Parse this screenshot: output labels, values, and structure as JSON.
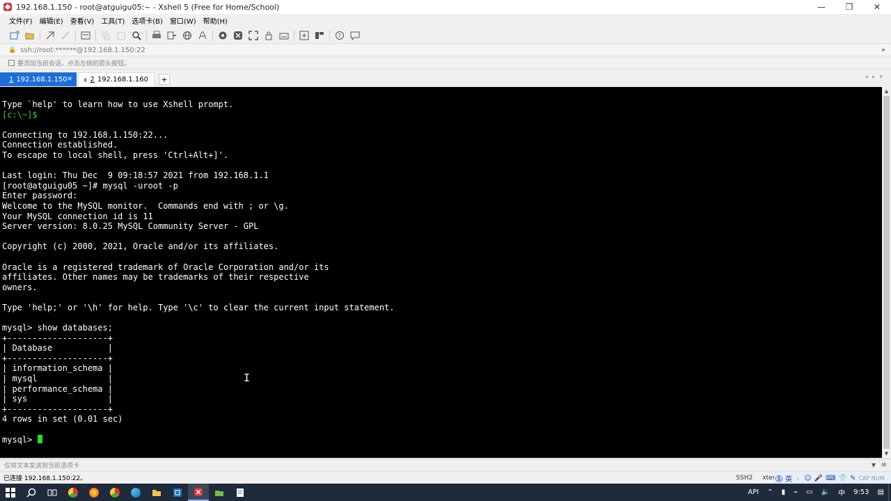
{
  "window": {
    "title": "192.168.1.150 - root@atguigu05:~ - Xshell 5 (Free for Home/School)",
    "controls": [
      "—",
      "❐",
      "✕"
    ]
  },
  "menu": [
    "文件(F)",
    "编辑(E)",
    "查看(V)",
    "工具(T)",
    "选项卡(B)",
    "窗口(W)",
    "帮助(H)"
  ],
  "toolbar_icons": [
    "new-session-icon",
    "open-folder-icon",
    "reconnect-icon",
    "disconnect-icon",
    "properties-icon",
    "copy-icon",
    "paste-icon",
    "find-icon",
    "print-icon",
    "transfer-icon",
    "globe-icon",
    "font-icon",
    "xftp-icon",
    "xshell-icon",
    "fullscreen-icon",
    "lock-icon",
    "keyboard-icon",
    "add-icon",
    "layout-icon",
    "help-icon",
    "chat-icon"
  ],
  "address": {
    "url": "ssh://root:******@192.168.1.150:22"
  },
  "hint": {
    "text": "要添加当前会话，点击左侧的箭头按钮。"
  },
  "tabs": [
    {
      "num": "1",
      "label": "192.168.1.150",
      "active": true,
      "dot_color": "#3cd23c"
    },
    {
      "num": "2",
      "label": "192.168.1.160",
      "active": false,
      "dot_color": "#2db32d"
    }
  ],
  "terminal": {
    "lines": [
      "Type `help' to learn how to use Xshell prompt.",
      "[c:\\~]$",
      "",
      "Connecting to 192.168.1.150:22...",
      "Connection established.",
      "To escape to local shell, press 'Ctrl+Alt+]'.",
      "",
      "Last login: Thu Dec  9 09:18:57 2021 from 192.168.1.1",
      "[root@atguigu05 ~]# mysql -uroot -p",
      "Enter password:",
      "Welcome to the MySQL monitor.  Commands end with ; or \\g.",
      "Your MySQL connection id is 11",
      "Server version: 8.0.25 MySQL Community Server - GPL",
      "",
      "Copyright (c) 2000, 2021, Oracle and/or its affiliates.",
      "",
      "Oracle is a registered trademark of Oracle Corporation and/or its",
      "affiliates. Other names may be trademarks of their respective",
      "owners.",
      "",
      "Type 'help;' or '\\h' for help. Type '\\c' to clear the current input statement.",
      "",
      "mysql> show databases;",
      "+--------------------+",
      "| Database           |",
      "+--------------------+",
      "| information_schema |",
      "| mysql              |",
      "| performance_schema |",
      "| sys                |",
      "+--------------------+",
      "4 rows in set (0.01 sec)",
      ""
    ],
    "green_line_index": 1,
    "prompt": "mysql> "
  },
  "compose": {
    "placeholder": "仅将文本发送到当前选项卡"
  },
  "status": {
    "left": "已连接 192.168.1.150:22。",
    "protocol": "SSH2",
    "term_type": "xterm",
    "size": "171x35",
    "ime_items": [
      "英",
      "ㆍ",
      "☺",
      "🎤",
      "⌨",
      "👕",
      "✎"
    ],
    "ime_tail": "CAP  NUM"
  },
  "taskbar": {
    "apps": [
      {
        "name": "start-icon",
        "glyph": "⊞"
      },
      {
        "name": "search-icon",
        "glyph": "⌕"
      },
      {
        "name": "task-view-icon",
        "glyph": "⧉"
      },
      {
        "name": "chrome-icon",
        "color": "#e8b62c"
      },
      {
        "name": "firefox-icon",
        "color": "#ff7a1a"
      },
      {
        "name": "chrome2-icon",
        "color": "#4caf50"
      },
      {
        "name": "edge-icon",
        "color": "#2a8bd8"
      },
      {
        "name": "explorer-icon",
        "color": "#f2c14e"
      },
      {
        "name": "terminal-app-icon",
        "color": "#3aa0d8"
      },
      {
        "name": "xshell-app-icon",
        "color": "#d4343a",
        "active": true
      },
      {
        "name": "xftp-app-icon",
        "color": "#7ab648"
      },
      {
        "name": "notepad-icon",
        "color": "#ffffff"
      }
    ],
    "tray_api": "API",
    "time": "9:53"
  }
}
